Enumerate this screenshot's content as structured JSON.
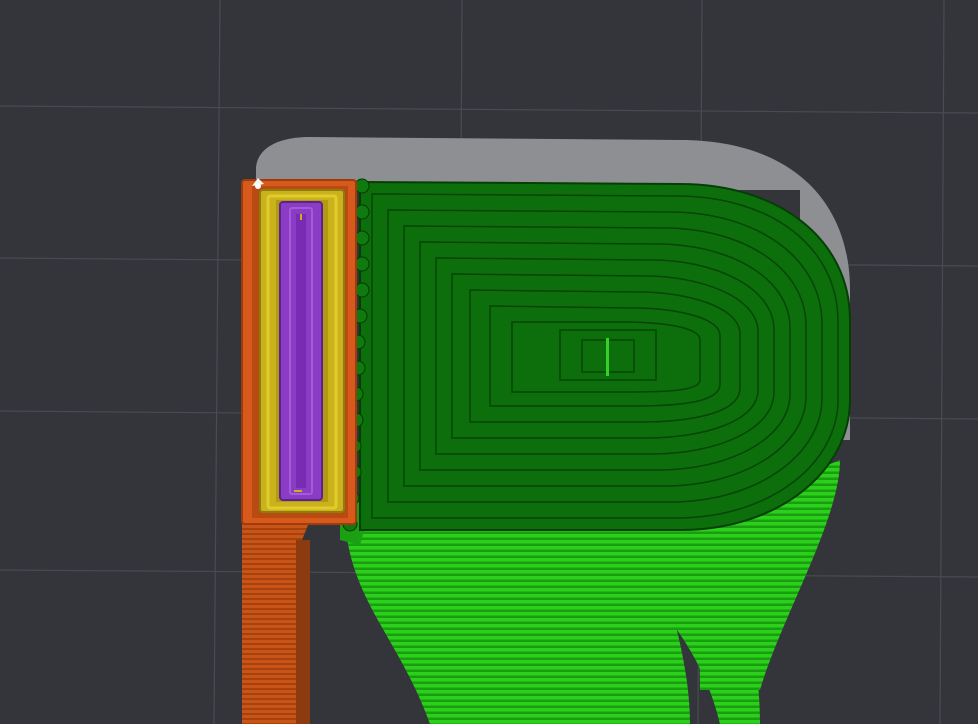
{
  "viewer": {
    "background_color": "#34353b",
    "grid_color": "#4a4b52",
    "colors": {
      "outer_wall": "#d8591c",
      "inner_wall": "#c9b21b",
      "infill": "#8b3cc4",
      "support_interface": "#0c6f0c",
      "support": "#2fcf1f",
      "ghost_layer": "#8d8f93"
    },
    "icons": {
      "seam_marker": "seam-marker-icon"
    }
  }
}
